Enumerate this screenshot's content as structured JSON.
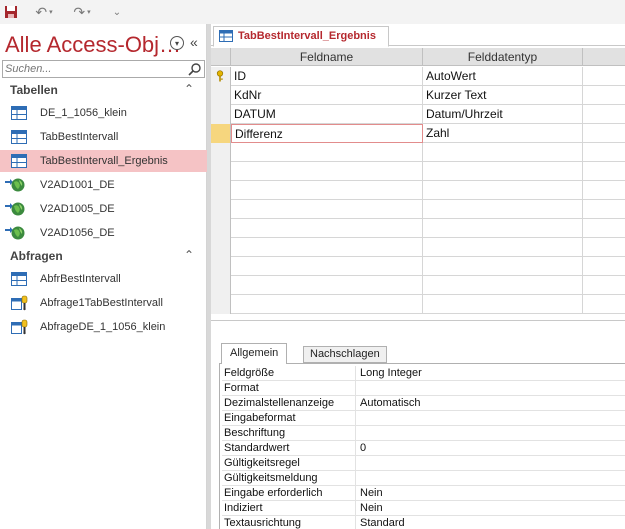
{
  "nav": {
    "title": "Alle Access-Obj…",
    "search_placeholder": "Suchen...",
    "groups": [
      {
        "label": "Tabellen",
        "items": [
          {
            "label": "DE_1_1056_klein",
            "icon": "table-icon"
          },
          {
            "label": "TabBestIntervall",
            "icon": "table-icon"
          },
          {
            "label": "TabBestIntervall_Ergebnis",
            "icon": "table-icon",
            "selected": true
          },
          {
            "label": "V2AD1001_DE",
            "icon": "linked-table-icon"
          },
          {
            "label": "V2AD1005_DE",
            "icon": "linked-table-icon"
          },
          {
            "label": "V2AD1056_DE",
            "icon": "linked-table-icon"
          }
        ]
      },
      {
        "label": "Abfragen",
        "items": [
          {
            "label": "AbfrBestIntervall",
            "icon": "query-icon"
          },
          {
            "label": "Abfrage1TabBestIntervall",
            "icon": "update-query-icon"
          },
          {
            "label": "AbfrageDE_1_1056_klein",
            "icon": "update-query-icon"
          }
        ]
      }
    ]
  },
  "document": {
    "tab_label": "TabBestIntervall_Ergebnis",
    "columns": [
      "Feldname",
      "Felddatentyp"
    ],
    "fields": [
      {
        "name": "ID",
        "type": "AutoWert",
        "primary_key": true
      },
      {
        "name": "KdNr",
        "type": "Kurzer Text"
      },
      {
        "name": "DATUM",
        "type": "Datum/Uhrzeit"
      },
      {
        "name": "Differenz",
        "type": "Zahl",
        "active": true
      }
    ]
  },
  "properties": {
    "tabs": [
      "Allgemein",
      "Nachschlagen"
    ],
    "active_tab": "Allgemein",
    "rows": [
      {
        "name": "Feldgröße",
        "value": "Long Integer"
      },
      {
        "name": "Format",
        "value": ""
      },
      {
        "name": "Dezimalstellenanzeige",
        "value": "Automatisch"
      },
      {
        "name": "Eingabeformat",
        "value": ""
      },
      {
        "name": "Beschriftung",
        "value": ""
      },
      {
        "name": "Standardwert",
        "value": "0"
      },
      {
        "name": "Gültigkeitsregel",
        "value": ""
      },
      {
        "name": "Gültigkeitsmeldung",
        "value": ""
      },
      {
        "name": "Eingabe erforderlich",
        "value": "Nein"
      },
      {
        "name": "Indiziert",
        "value": "Nein"
      },
      {
        "name": "Textausrichtung",
        "value": "Standard"
      }
    ]
  },
  "colors": {
    "accent": "#b5282e",
    "selection": "#f5c3c5",
    "row_selector_active": "#f6d67e"
  }
}
